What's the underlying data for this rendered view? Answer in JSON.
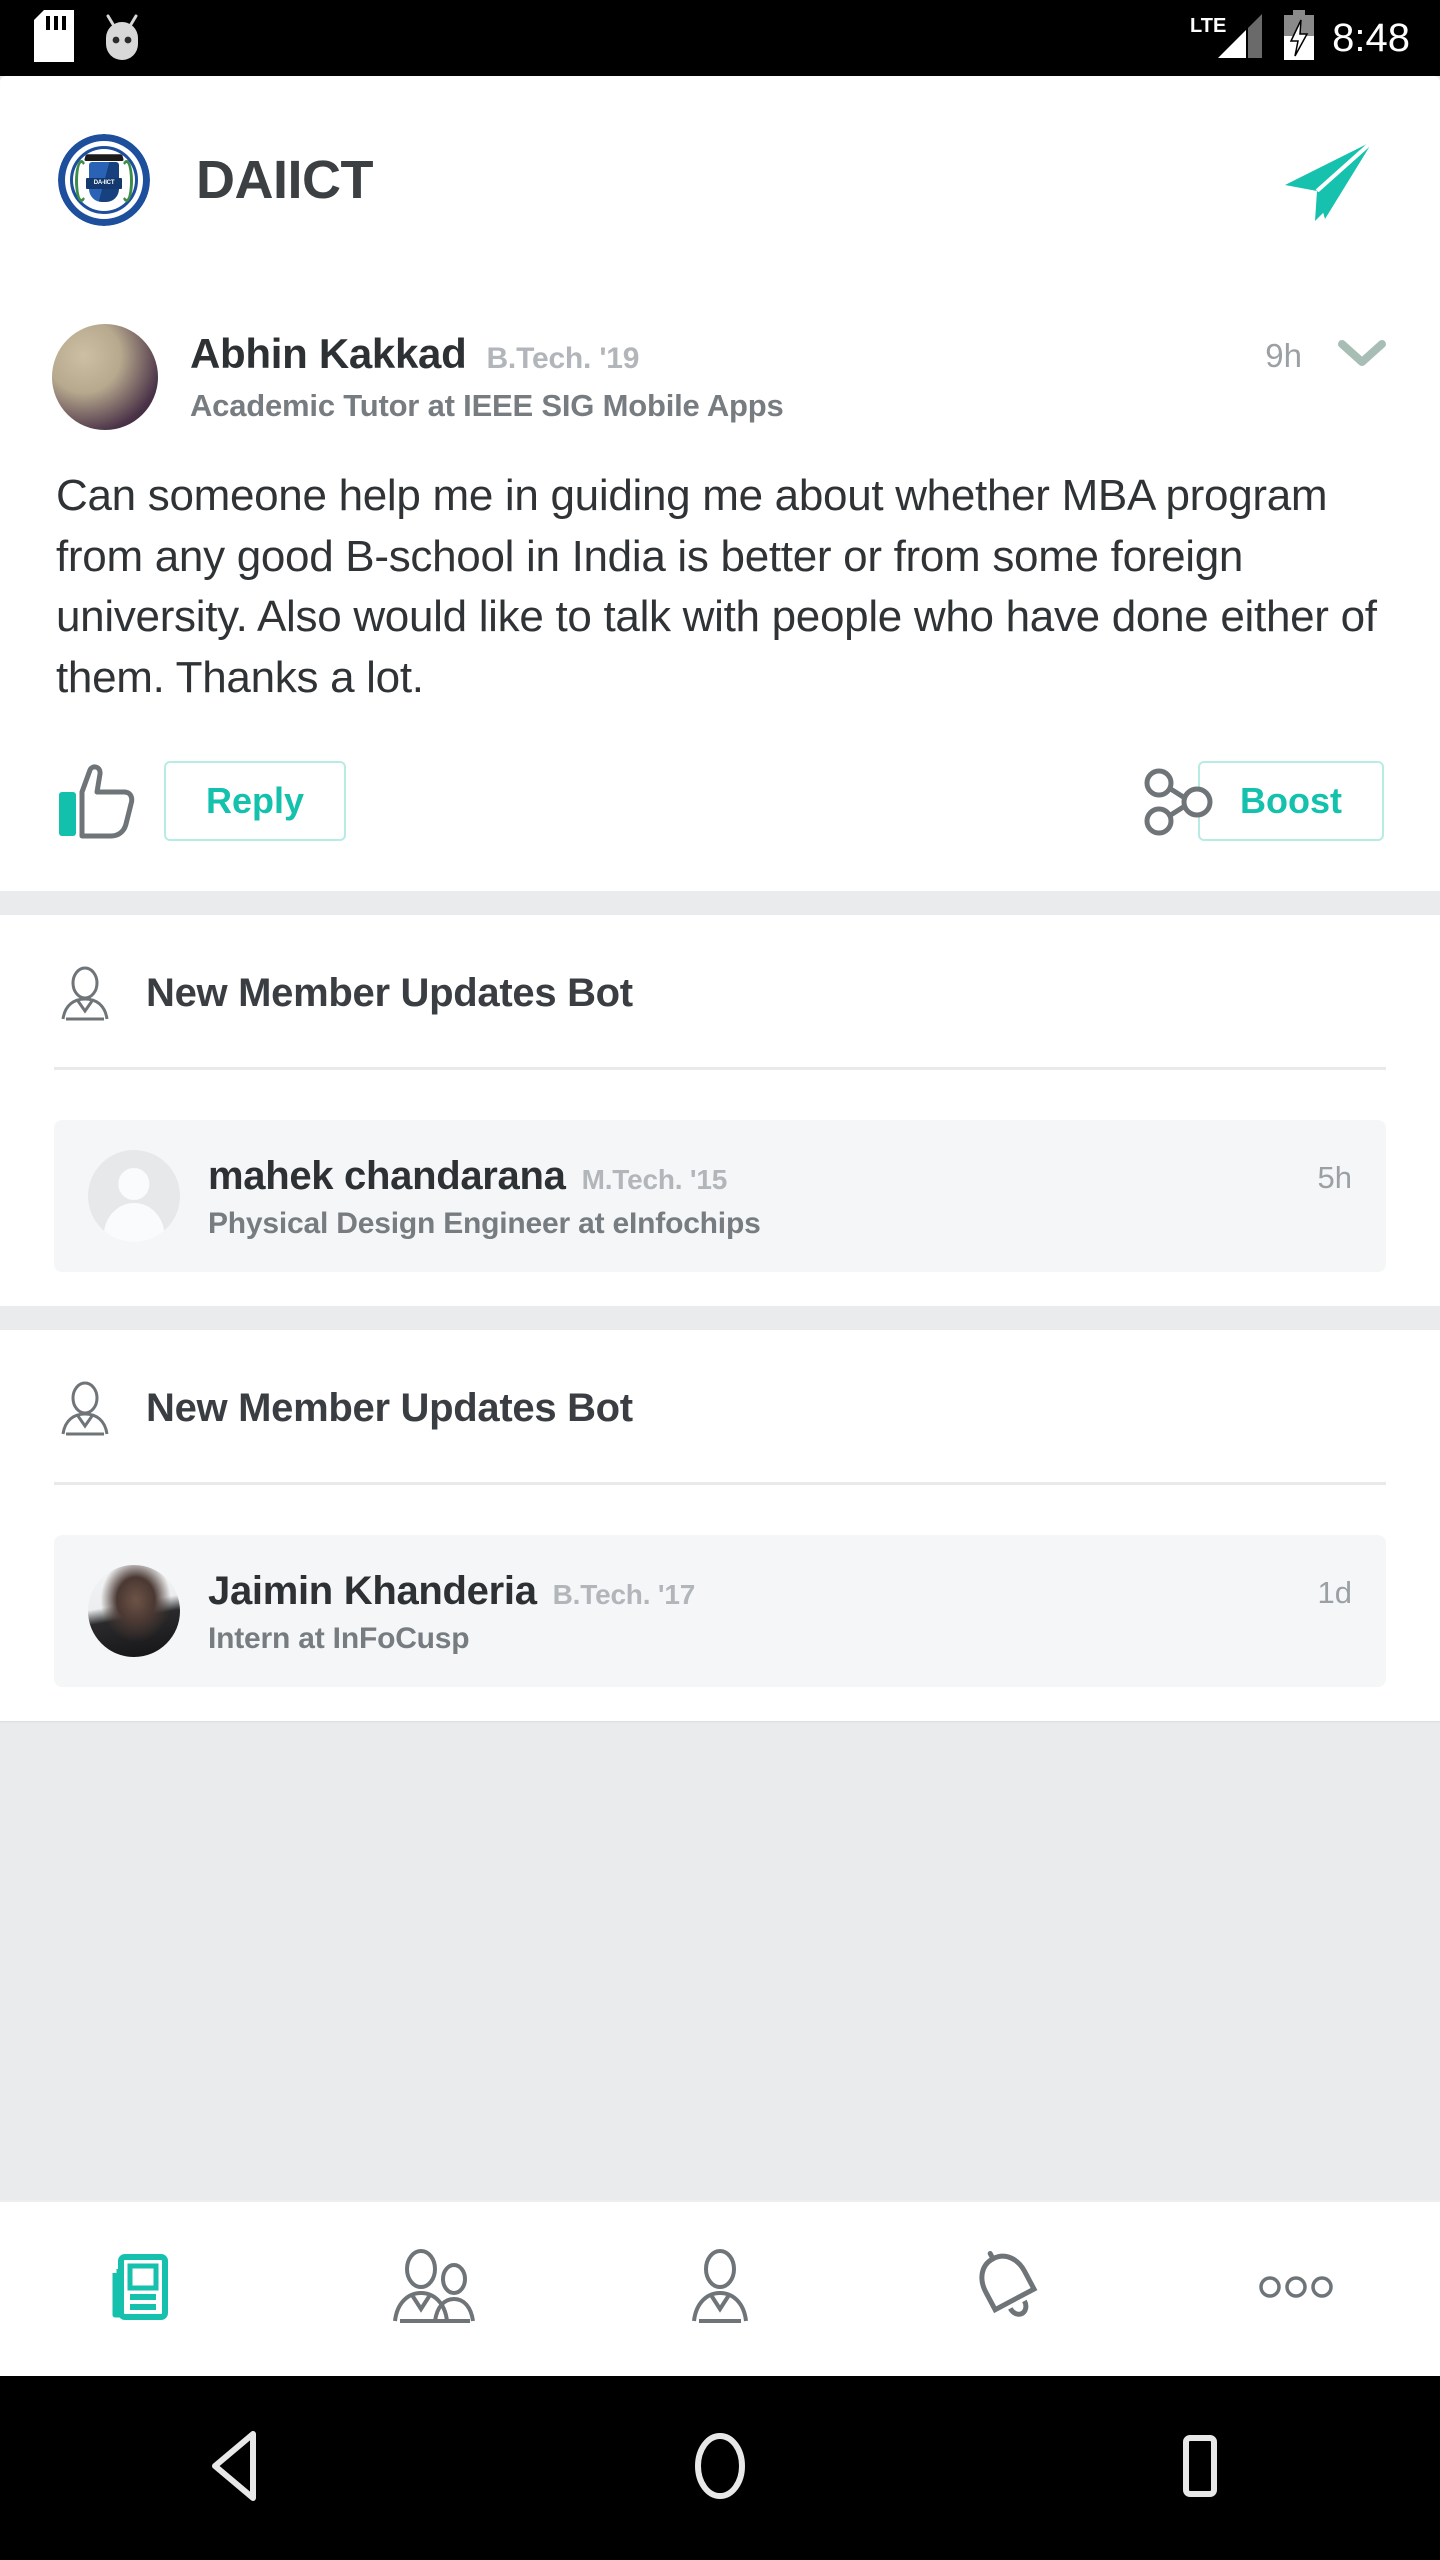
{
  "status_bar": {
    "icons": [
      "sd-card-icon",
      "android-head-icon"
    ],
    "network_label": "LTE",
    "signal_icon": "signal-bars-icon",
    "battery_icon": "battery-charging-icon",
    "time": "8:48"
  },
  "header": {
    "logo_icon": "daiict-logo",
    "logo_text": "DA-IICT",
    "title": "DAIICT",
    "send_icon": "send-paper-plane-icon"
  },
  "post": {
    "avatar_icon": "user-avatar-photo",
    "author": "Abhin Kakkad",
    "degree": "B.Tech. '19",
    "headline": "Academic Tutor at IEEE SIG Mobile Apps",
    "timestamp": "9h",
    "chevron_icon": "chevron-down-icon",
    "body": "Can someone help me in guiding me about whether MBA program from any good B-school in India is better or from some foreign university. Also would like to talk with people who have done either of them. Thanks a lot.",
    "like_icon": "thumbs-up-icon",
    "reply_label": "Reply",
    "boost_icon": "share-network-icon",
    "boost_label": "Boost"
  },
  "bot_sections": [
    {
      "bot_icon": "bot-person-icon",
      "title": "New Member Updates Bot",
      "member": {
        "avatar_icon": "placeholder-avatar-icon",
        "name": "mahek chandarana",
        "degree": "M.Tech. '15",
        "headline": "Physical Design Engineer at eInfochips",
        "timestamp": "5h"
      }
    },
    {
      "bot_icon": "bot-person-icon",
      "title": "New Member Updates Bot",
      "member": {
        "avatar_icon": "user-avatar-photo",
        "name": "Jaimin Khanderia",
        "degree": "B.Tech. '17",
        "headline": "Intern at InFoCusp",
        "timestamp": "1d"
      }
    }
  ],
  "bottom_nav": [
    {
      "icon": "feed-news-icon",
      "active": true
    },
    {
      "icon": "people-group-icon",
      "active": false
    },
    {
      "icon": "person-icon",
      "active": false
    },
    {
      "icon": "bell-icon",
      "active": false
    },
    {
      "icon": "more-dots-icon",
      "active": false
    }
  ],
  "android_nav": [
    {
      "icon": "back-triangle-icon"
    },
    {
      "icon": "home-circle-icon"
    },
    {
      "icon": "recents-square-icon"
    }
  ],
  "colors": {
    "accent_teal": "#14c1ac",
    "accent_teal_light": "#b7ece4",
    "page_bg": "#e9ebed",
    "card_bg": "#ffffff",
    "text_primary": "#2d3134",
    "text_secondary": "#777c80",
    "text_muted": "#9aa0a4",
    "brand_blue": "#1d4f9c"
  }
}
